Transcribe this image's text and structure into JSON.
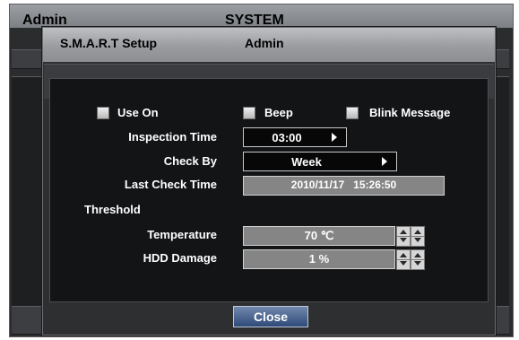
{
  "background": {
    "user": "Admin",
    "title": "SYSTEM"
  },
  "dialog": {
    "title": "S.M.A.R.T Setup",
    "user": "Admin",
    "checkboxes": {
      "use_on": {
        "label": "Use On",
        "checked": false
      },
      "beep": {
        "label": "Beep",
        "checked": false
      },
      "blink_message": {
        "label": "Blink Message",
        "checked": false
      }
    },
    "inspection_time": {
      "label": "Inspection Time",
      "value": "03:00"
    },
    "check_by": {
      "label": "Check By",
      "value": "Week"
    },
    "last_check_time": {
      "label": "Last Check Time",
      "value": "2010/11/17   15:26:50"
    },
    "threshold": {
      "label": "Threshold",
      "temperature": {
        "label": "Temperature",
        "value": "70 ℃"
      },
      "hdd_damage": {
        "label": "HDD Damage",
        "value": "1 %"
      }
    },
    "close_label": "Close"
  },
  "colors": {
    "title_bar": "#9a9ca0",
    "panel_bg": "#131416",
    "close_button": "#2e4a78"
  }
}
